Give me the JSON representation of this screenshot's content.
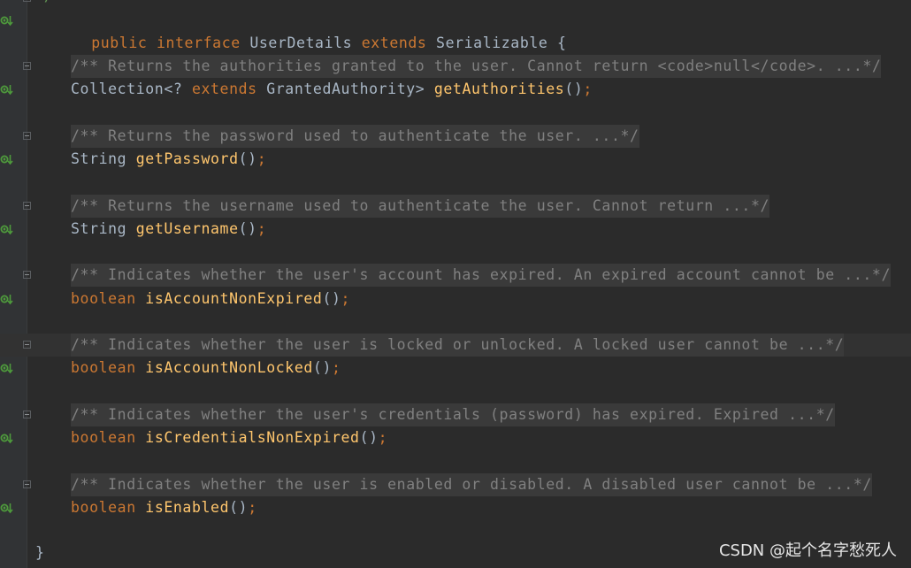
{
  "editor": {
    "top_comment_fragment": "*/",
    "interface_line": {
      "kw_public": "public",
      "kw_interface": "interface",
      "name": "UserDetails",
      "kw_extends": "extends",
      "parent": "Serializable",
      "brace": "{"
    },
    "closing_brace": "}",
    "members": [
      {
        "comment": "/** Returns the authorities granted to the user. Cannot return <code>null</code>. ...*/",
        "type_plain": "Collection<? ",
        "type_kw": "extends",
        "type_rest": " GrantedAuthority> ",
        "method": "getAuthorities",
        "parens": "()",
        "semi": ";"
      },
      {
        "comment": "/** Returns the password used to authenticate the user. ...*/",
        "type_plain": "String ",
        "type_kw": "",
        "type_rest": "",
        "method": "getPassword",
        "parens": "()",
        "semi": ";"
      },
      {
        "comment": "/** Returns the username used to authenticate the user. Cannot return ...*/",
        "type_plain": "String ",
        "type_kw": "",
        "type_rest": "",
        "method": "getUsername",
        "parens": "()",
        "semi": ";"
      },
      {
        "comment": "/** Indicates whether the user's account has expired. An expired account cannot be ...*/",
        "type_plain": "",
        "type_kw": "boolean",
        "type_rest": " ",
        "method": "isAccountNonExpired",
        "parens": "()",
        "semi": ";"
      },
      {
        "comment": "/** Indicates whether the user is locked or unlocked. A locked user cannot be ...*/",
        "type_plain": "",
        "type_kw": "boolean",
        "type_rest": " ",
        "method": "isAccountNonLocked",
        "parens": "()",
        "semi": ";"
      },
      {
        "comment": "/** Indicates whether the user's credentials (password) has expired. Expired ...*/",
        "type_plain": "",
        "type_kw": "boolean",
        "type_rest": " ",
        "method": "isCredentialsNonExpired",
        "parens": "()",
        "semi": ";"
      },
      {
        "comment": "/** Indicates whether the user is enabled or disabled. A disabled user cannot be ...*/",
        "type_plain": "",
        "type_kw": "boolean",
        "type_rest": " ",
        "method": "isEnabled",
        "parens": "()",
        "semi": ";"
      }
    ],
    "watermark": "CSDN @起个名字愁死人"
  },
  "colors": {
    "background": "#2b2b2b",
    "gutter": "#313335",
    "keyword": "#cc7832",
    "method": "#ffc66d",
    "text": "#a9b7c6",
    "comment": "#808080",
    "implemented_icon": "#4e9a3c"
  },
  "icons": {
    "gutter_marker": "implemented-method-icon",
    "fold_marker": "fold-collapse-icon"
  }
}
